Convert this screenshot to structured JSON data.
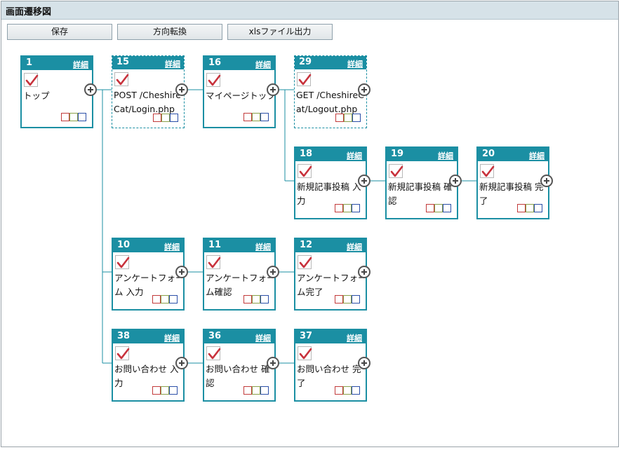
{
  "window": {
    "title": "画面遷移図"
  },
  "toolbar": {
    "save_label": "保存",
    "direction_label": "方向転換",
    "xls_label": "xlsファイル出力"
  },
  "detail_label": "詳細",
  "nodes": [
    {
      "id": "1",
      "label": "トップ",
      "dashed": false
    },
    {
      "id": "15",
      "label": "POST /CheshireCat/Login.php",
      "dashed": true
    },
    {
      "id": "16",
      "label": "マイページトップ",
      "dashed": false
    },
    {
      "id": "29",
      "label": "GET /CheshireCat/Logout.php",
      "dashed": true
    },
    {
      "id": "18",
      "label": "新規記事投稿 入力",
      "dashed": false
    },
    {
      "id": "19",
      "label": "新規記事投稿 確認",
      "dashed": false
    },
    {
      "id": "20",
      "label": "新規記事投稿 完了",
      "dashed": false
    },
    {
      "id": "10",
      "label": "アンケートフォーム 入力",
      "dashed": false
    },
    {
      "id": "11",
      "label": "アンケートフォーム確認",
      "dashed": false
    },
    {
      "id": "12",
      "label": "アンケートフォーム完了",
      "dashed": false
    },
    {
      "id": "38",
      "label": "お問い合わせ 入力",
      "dashed": false
    },
    {
      "id": "36",
      "label": "お問い合わせ 確認",
      "dashed": false
    },
    {
      "id": "37",
      "label": "お問い合わせ 完了",
      "dashed": false
    }
  ],
  "colors": {
    "accent": "#1b8fa3",
    "titlebar": "#d6e2e8",
    "check": "#c8323c",
    "status_red": "#c23b3b",
    "status_green": "#8aa04a",
    "status_blue": "#2b4fa8"
  }
}
